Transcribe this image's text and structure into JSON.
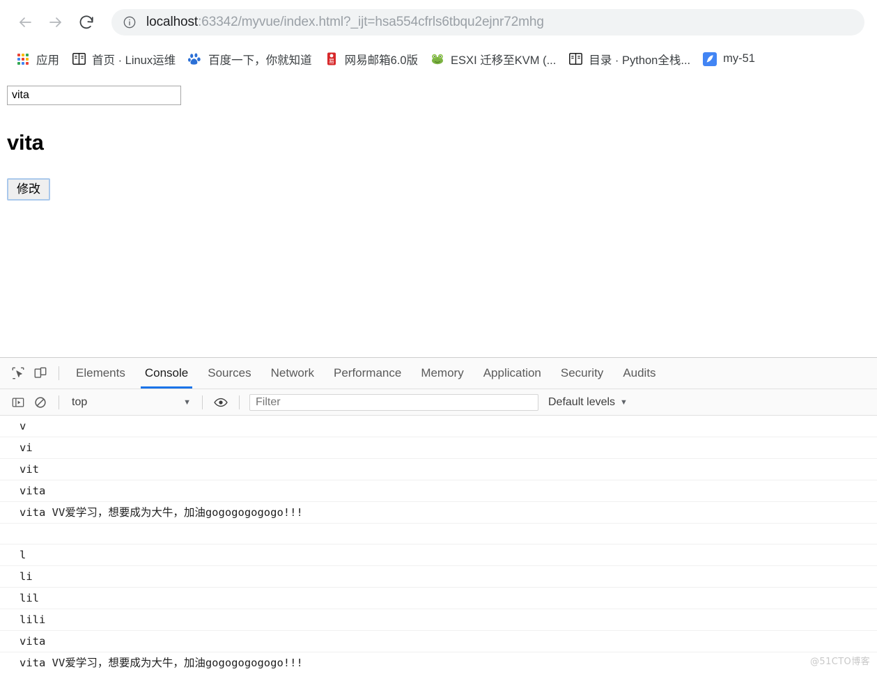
{
  "browser": {
    "nav": {
      "back_icon": "arrow-left-icon",
      "forward_icon": "arrow-right-icon",
      "reload_icon": "reload-icon"
    },
    "omnibox": {
      "info_icon": "info-circle-icon",
      "url_host": "localhost",
      "url_rest": ":63342/myvue/index.html?_ijt=hsa554cfrls6tbqu2ejnr72mhg",
      "full_url": "localhost:63342/myvue/index.html?_ijt=hsa554cfrls6tbqu2ejnr72mhg"
    },
    "bookmarks": [
      {
        "label": "应用",
        "icon": "apps-grid-icon"
      },
      {
        "label": "首页 · Linux运维",
        "icon": "book-icon"
      },
      {
        "label": "百度一下，你就知道",
        "icon": "baidu-paw-icon"
      },
      {
        "label": "网易邮箱6.0版",
        "icon": "netease-mail-icon"
      },
      {
        "label": "ESXI 迁移至KVM (...",
        "icon": "frog-icon"
      },
      {
        "label": "目录 · Python全栈...",
        "icon": "book-icon"
      },
      {
        "label": "my-51",
        "icon": "feather-icon"
      }
    ]
  },
  "page": {
    "input_value": "vita",
    "input_placeholder": "",
    "heading": "vita",
    "button_label": "修改"
  },
  "devtools": {
    "inspect_icon": "inspect-element-icon",
    "device_icon": "device-toolbar-icon",
    "tabs": [
      {
        "label": "Elements",
        "active": false
      },
      {
        "label": "Console",
        "active": true
      },
      {
        "label": "Sources",
        "active": false
      },
      {
        "label": "Network",
        "active": false
      },
      {
        "label": "Performance",
        "active": false
      },
      {
        "label": "Memory",
        "active": false
      },
      {
        "label": "Application",
        "active": false
      },
      {
        "label": "Security",
        "active": false
      },
      {
        "label": "Audits",
        "active": false
      }
    ],
    "console_toolbar": {
      "sidebar_icon": "console-sidebar-icon",
      "clear_icon": "clear-console-icon",
      "context": "top",
      "context_caret": "▼",
      "eye_icon": "live-expression-eye-icon",
      "filter_placeholder": "Filter",
      "filter_value": "",
      "levels": "Default levels",
      "levels_caret": "▼"
    },
    "log_rows": [
      {
        "type": "log",
        "text": "v"
      },
      {
        "type": "log",
        "text": "vi"
      },
      {
        "type": "log",
        "text": "vit"
      },
      {
        "type": "log",
        "text": "vita"
      },
      {
        "type": "log",
        "text": "vita VV爱学习，想要成为大牛，加油gogogogogogo!!!"
      },
      {
        "type": "spacer",
        "text": ""
      },
      {
        "type": "log",
        "text": "l"
      },
      {
        "type": "log",
        "text": "li"
      },
      {
        "type": "log",
        "text": "lil"
      },
      {
        "type": "log",
        "text": "lili"
      },
      {
        "type": "log",
        "text": "vita"
      },
      {
        "type": "log",
        "text": "vita VV爱学习，想要成为大牛，加油gogogogogogo!!!"
      }
    ]
  },
  "watermark": "@51CTO博客",
  "colors": {
    "accent": "#1a73e8",
    "omnibox_bg": "#f1f3f4",
    "url_gray": "#9aa0a6",
    "text_dark": "#202124"
  }
}
